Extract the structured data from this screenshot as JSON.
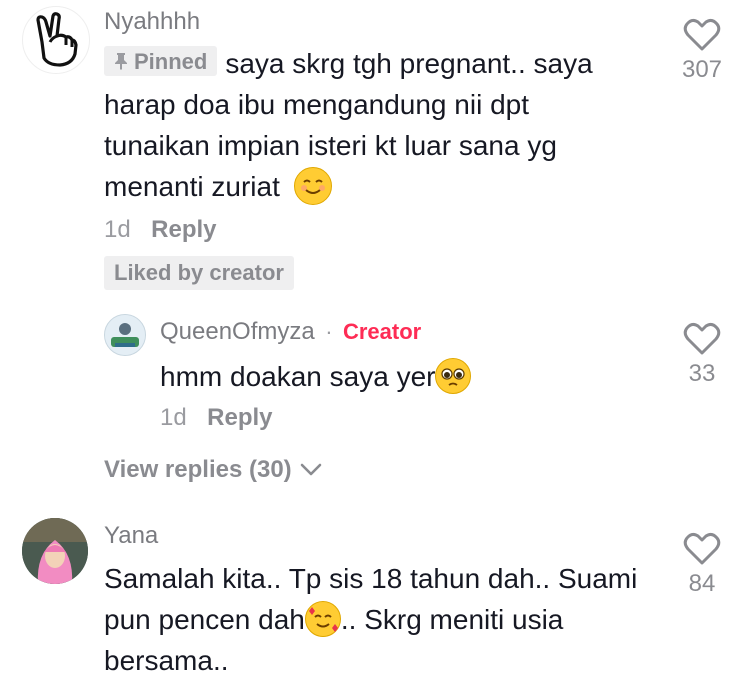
{
  "comments": [
    {
      "username": "Nyahhhh",
      "pinned_label": "Pinned",
      "text_line1": "saya skrg tgh pregnant.. saya",
      "text_line2": "harap doa ibu mengandung nii dpt",
      "text_line3": "tunaikan impian isteri kt luar sana yg",
      "text_line4": "menanti zuriat",
      "time": "1d",
      "reply_label": "Reply",
      "liked_by_creator": "Liked by creator",
      "likes": "307",
      "avatar_icon": "peace-hand-icon"
    },
    {
      "username": "QueenOfmyza",
      "separator": "·",
      "creator_label": "Creator",
      "text": "hmm doakan saya yer",
      "time": "1d",
      "reply_label": "Reply",
      "likes": "33"
    },
    {
      "username": "Yana",
      "text_line1": "Samalah kita.. Tp sis 18 tahun dah.. Suami",
      "text_line2a": "pun pencen dah",
      "text_line2b": ".. Skrg meniti usia",
      "text_line3": "bersama..",
      "likes": "84"
    }
  ],
  "view_replies_label": "View replies (30)",
  "colors": {
    "creator": "#fe2c55",
    "muted": "#8a8b90",
    "text": "#161823"
  }
}
